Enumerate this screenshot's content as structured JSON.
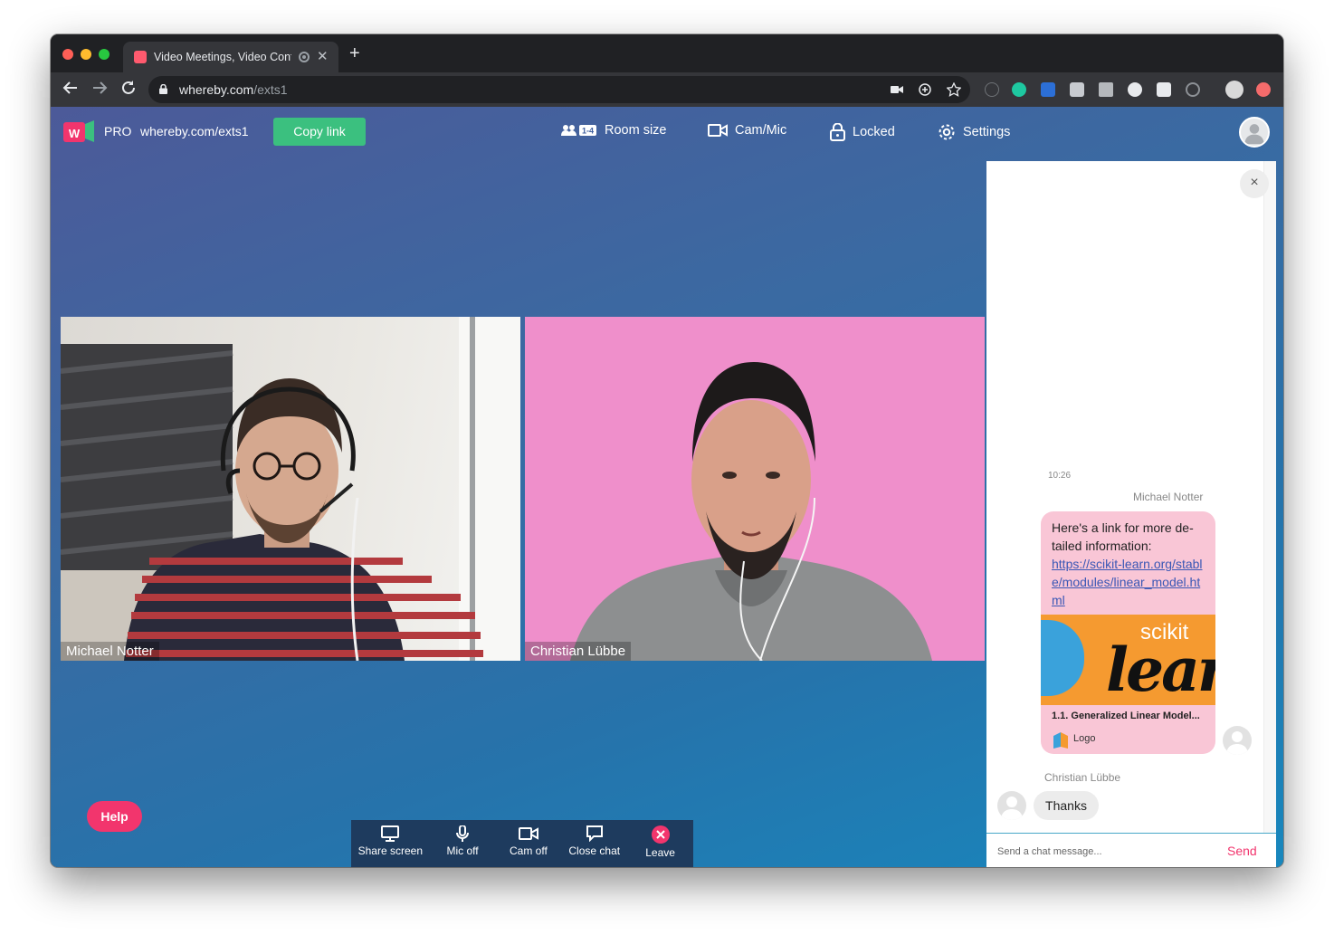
{
  "browser": {
    "tab_title": "Video Meetings, Video Conferencing",
    "new_tab": "+",
    "url_host": "whereby.com",
    "url_path": "/exts1"
  },
  "app": {
    "plan": "PRO",
    "room_url": "whereby.com/exts1",
    "copy_link": "Copy link",
    "room_size_badge": "1-4",
    "room_size": "Room size",
    "cam_mic": "Cam/Mic",
    "locked": "Locked",
    "settings": "Settings",
    "help": "Help"
  },
  "participants": [
    {
      "name": "Michael Notter"
    },
    {
      "name": "Christian Lübbe"
    }
  ],
  "controls": {
    "share_screen": "Share screen",
    "mic_off": "Mic off",
    "cam_off": "Cam off",
    "close_chat": "Close chat",
    "leave": "Leave"
  },
  "chat": {
    "close": "×",
    "timestamp": "10:26",
    "message1": {
      "sender": "Michael Notter",
      "text": "Here's a link for more de-tailed information:",
      "link": "https://scikit-learn.org/stable/modules/linear_model.html",
      "preview_brand_small": "scikit",
      "preview_brand_large": "lear",
      "preview_title": "1.1. Generalized Linear Model...",
      "preview_logo_label": "Logo"
    },
    "message2": {
      "sender": "Christian Lübbe",
      "text": "Thanks"
    },
    "input_placeholder": "Send a chat message...",
    "send": "Send"
  },
  "colors": {
    "brand_green": "#3bc07f",
    "brand_pink": "#f2356d",
    "chat_bubble": "#f9c6d6",
    "control_bar": "#1e3b5e"
  }
}
